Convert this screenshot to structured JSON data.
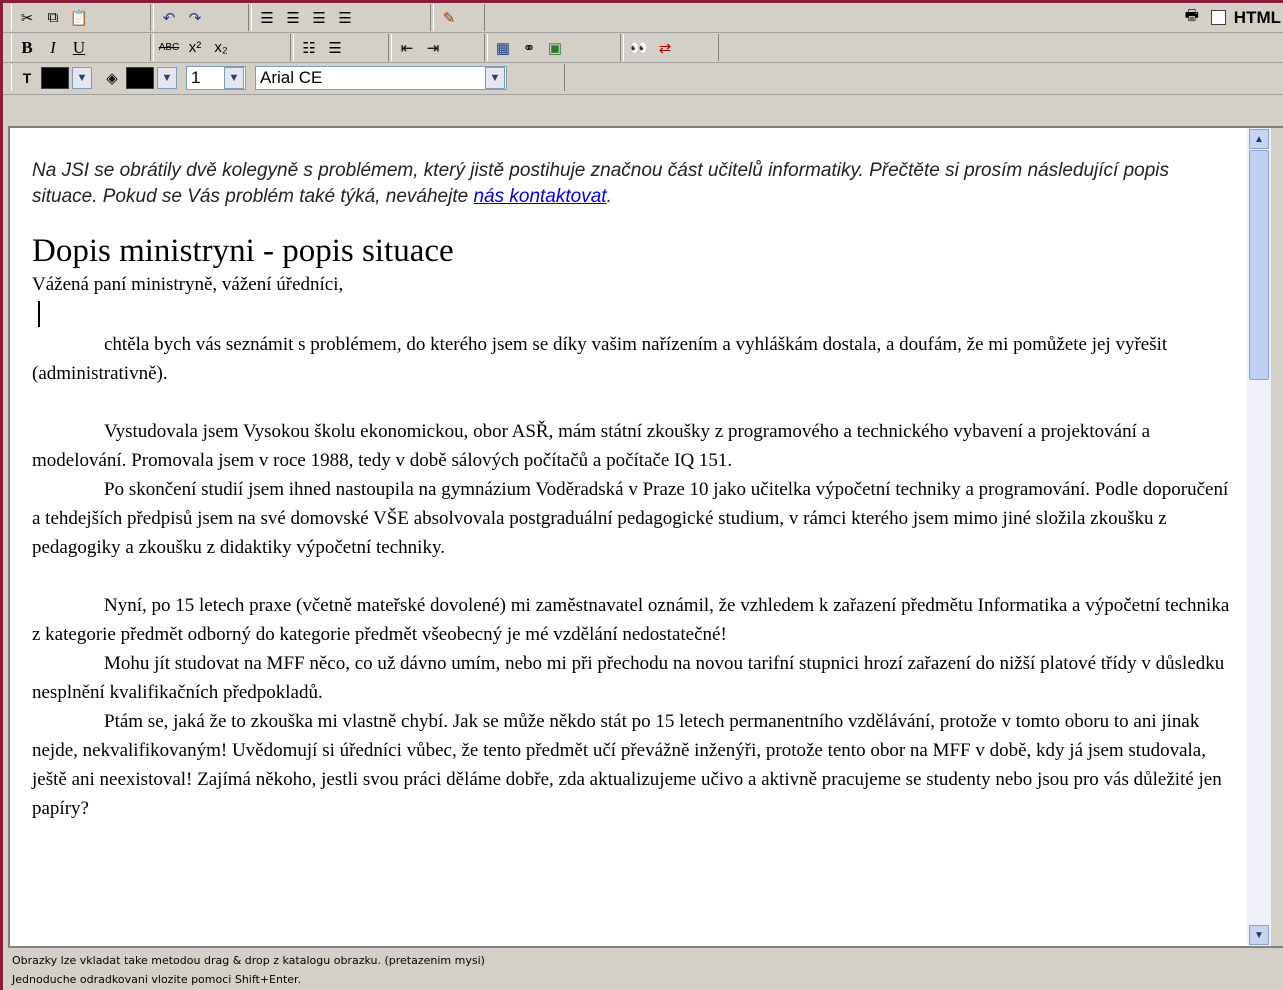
{
  "toolbar": {
    "html_label": "HTML",
    "font_size_value": "1",
    "font_name_value": "Arial CE",
    "format_buttons": {
      "bold": "B",
      "italic": "I",
      "underline": "U"
    }
  },
  "content": {
    "intro_before_link": "Na JSI se obrátily dvě kolegyně s problémem, který jistě postihuje značnou část učitelů informatiky. Přečtěte si prosím následující popis situace. Pokud se Vás problém také týká, neváhejte ",
    "intro_link": "nás kontaktovat",
    "intro_after_link": ".",
    "heading": "Dopis ministryni - popis situace",
    "salutation": "Vážená paní ministryně, vážení úředníci,",
    "paragraphs": [
      "chtěla bych vás seznámit s problémem, do kterého jsem se díky vašim nařízením a vyhláškám dostala, a doufám, že mi pomůžete jej vyřešit (administrativně).",
      "Vystudovala jsem Vysokou školu ekonomickou, obor ASŘ, mám státní zkoušky z programového a technického vybavení a projektování a modelování. Promovala jsem v roce 1988, tedy v době sálových  počítačů a počítače IQ 151.",
      "Po skončení studií jsem ihned nastoupila na gymnázium Voděradská v Praze 10 jako učitelka výpočetní techniky a programování. Podle doporučení a tehdejších předpisů jsem na své domovské VŠE absolvovala postgraduální pedagogické studium, v rámci kterého jsem mimo jiné složila zkoušku z pedagogiky a zkoušku z didaktiky výpočetní techniky.",
      "Nyní, po 15 letech praxe (včetně mateřské dovolené) mi zaměstnavatel oznámil, že vzhledem k zařazení předmětu Informatika a výpočetní technika z kategorie předmět odborný do kategorie předmět všeobecný je mé vzdělání nedostatečné!",
      "Mohu jít studovat na MFF něco, co už dávno umím, nebo mi při přechodu na novou tarifní stupnici hrozí zařazení do nižší platové třídy v důsledku nesplnění kvalifikačních předpokladů.",
      "Ptám se, jaká že to zkouška mi vlastně chybí. Jak se může někdo stát po 15 letech permanentního vzdělávání, protože v tomto oboru to ani jinak nejde, nekvalifikovaným! Uvědomují si úředníci vůbec, že tento předmět učí převážně inženýři, protože tento obor na MFF v době, kdy já jsem studovala, ještě ani neexistoval! Zajímá někoho, jestli svou práci děláme dobře, zda aktualizujeme učivo a aktivně pracujeme se studenty nebo jsou pro vás důležité jen papíry?"
    ]
  },
  "status": {
    "line1": "Obrazky lze vkladat take metodou drag & drop z katalogu obrazku. (pretazenim mysi)",
    "line2": "Jednoduche odradkovani vlozite pomoci Shift+Enter."
  }
}
